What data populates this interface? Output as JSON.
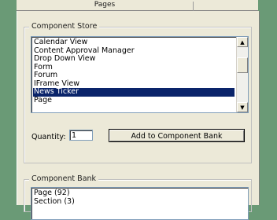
{
  "tabs": {
    "pages_label": "Pages"
  },
  "component_store": {
    "label": "Component Store",
    "items": [
      {
        "label": "Calendar View",
        "selected": false
      },
      {
        "label": "Content Approval Manager",
        "selected": false
      },
      {
        "label": "Drop Down View",
        "selected": false
      },
      {
        "label": "Form",
        "selected": false
      },
      {
        "label": "Forum",
        "selected": false
      },
      {
        "label": "IFrame View",
        "selected": false
      },
      {
        "label": "News Ticker",
        "selected": true
      },
      {
        "label": "Page",
        "selected": false
      }
    ],
    "quantity_label": "Quantity:",
    "quantity_value": "1",
    "add_button_label": "Add to Component Bank"
  },
  "component_bank": {
    "label": "Component Bank",
    "items": [
      {
        "label": "Page (92)"
      },
      {
        "label": "Section (3)"
      }
    ]
  },
  "colors": {
    "background": "#6a9a76",
    "panel": "#ece9d8",
    "selection": "#0a246a"
  }
}
